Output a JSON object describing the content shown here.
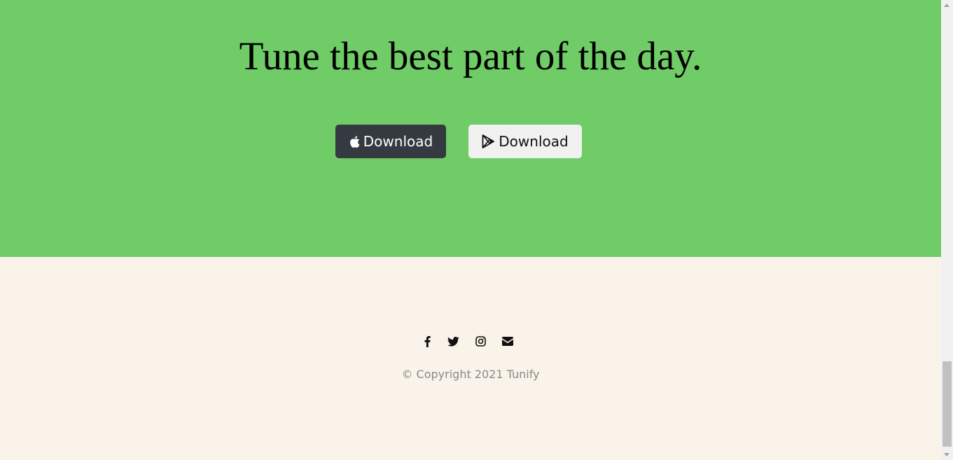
{
  "cta": {
    "heading": "Tune the best part of the day.",
    "background_color": "#6fcc66",
    "apple_button": {
      "icon": "apple-icon",
      "label": "Download"
    },
    "google_button": {
      "icon": "google-play-icon",
      "label": "Download"
    }
  },
  "footer": {
    "background_color": "#faf3ea",
    "social_icons": [
      "facebook-icon",
      "twitter-icon",
      "instagram-icon",
      "envelope-icon"
    ],
    "copyright": "© Copyright 2021 Tunify",
    "copyright_color": "#8a8a8a",
    "icon_color": "#111111"
  },
  "scrollbar": {
    "position": "bottom"
  }
}
